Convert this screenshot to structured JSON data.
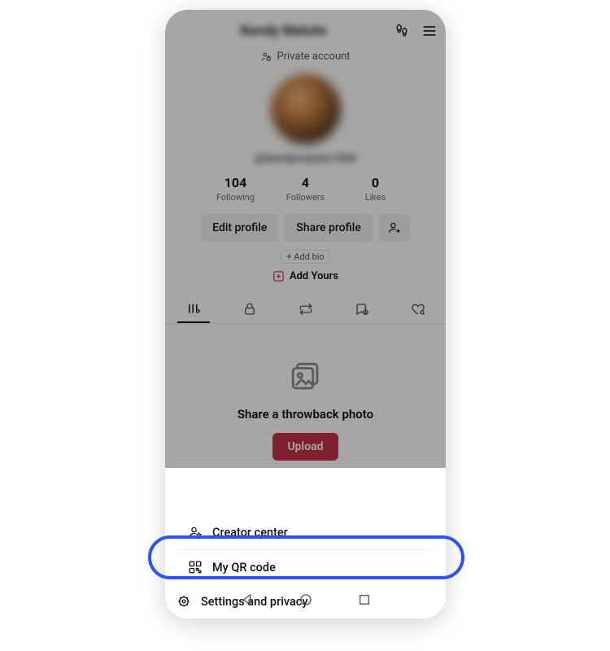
{
  "header": {
    "username_placeholder": "Kendy Matute",
    "private_label": "Private account"
  },
  "profile": {
    "handle_placeholder": "@kendymatute1000",
    "stats": {
      "following": {
        "value": "104",
        "label": "Following"
      },
      "followers": {
        "value": "4",
        "label": "Followers"
      },
      "likes": {
        "value": "0",
        "label": "Likes"
      }
    },
    "edit_profile_label": "Edit profile",
    "share_profile_label": "Share profile",
    "add_bio_label": "+ Add bio",
    "add_yours_label": "Add Yours",
    "empty_state_message": "Share a throwback photo",
    "upload_label": "Upload"
  },
  "sheet": {
    "items": [
      {
        "icon": "user-star-icon",
        "label": "Creator center"
      },
      {
        "icon": "qr-code-icon",
        "label": "My QR code"
      },
      {
        "icon": "gear-icon",
        "label": "Settings and privacy"
      }
    ]
  }
}
